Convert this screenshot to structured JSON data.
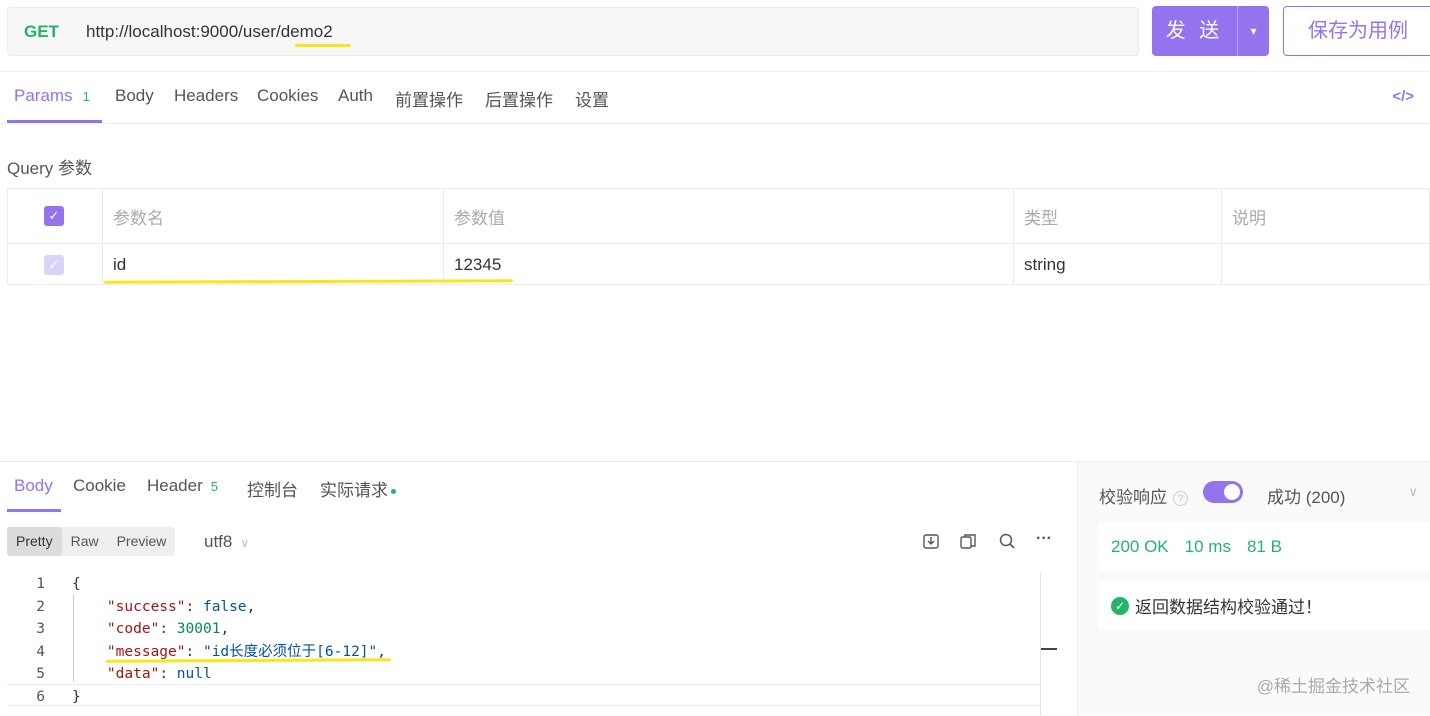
{
  "request": {
    "method": "GET",
    "url_prefix": "http://localhost:9000/user/",
    "url_highlight": "demo2",
    "send_label": "发 送",
    "save_label": "保存为用例"
  },
  "request_tabs": {
    "params_label": "Params",
    "params_count": "1",
    "items": [
      "Body",
      "Headers",
      "Cookies",
      "Auth",
      "前置操作",
      "后置操作",
      "设置"
    ],
    "code_icon": "</>"
  },
  "query": {
    "section_label": "Query 参数",
    "headers": [
      "参数名",
      "参数值",
      "类型",
      "说明"
    ],
    "rows": [
      {
        "name": "id",
        "value": "12345",
        "type": "string",
        "desc": ""
      }
    ]
  },
  "response_tabs": {
    "body": "Body",
    "cookie": "Cookie",
    "header": "Header",
    "header_count": "5",
    "console": "控制台",
    "actual_request": "实际请求"
  },
  "format": {
    "options": [
      "Pretty",
      "Raw",
      "Preview"
    ],
    "active": "Pretty",
    "encoding": "utf8"
  },
  "code_lines": [
    {
      "num": "1",
      "parts": [
        [
          "p",
          "{"
        ]
      ]
    },
    {
      "num": "2",
      "parts": [
        [
          "p",
          "    "
        ],
        [
          "k",
          "\"success\""
        ],
        [
          "p",
          ": "
        ],
        [
          "b",
          "false"
        ],
        [
          "p",
          ","
        ]
      ]
    },
    {
      "num": "3",
      "parts": [
        [
          "p",
          "    "
        ],
        [
          "k",
          "\"code\""
        ],
        [
          "p",
          ": "
        ],
        [
          "n",
          "30001"
        ],
        [
          "p",
          ","
        ]
      ]
    },
    {
      "num": "4",
      "parts": [
        [
          "p",
          "    "
        ],
        [
          "k",
          "\"message\""
        ],
        [
          "p",
          ": "
        ],
        [
          "s",
          "\"id长度必须位于[6-12]\""
        ],
        [
          "p",
          ","
        ]
      ]
    },
    {
      "num": "5",
      "parts": [
        [
          "p",
          "    "
        ],
        [
          "k",
          "\"data\""
        ],
        [
          "p",
          ": "
        ],
        [
          "b",
          "null"
        ]
      ]
    },
    {
      "num": "6",
      "parts": [
        [
          "p",
          "}"
        ]
      ]
    }
  ],
  "validation": {
    "title": "校验响应",
    "help": "?",
    "status": "成功 (200)",
    "code": "200 OK",
    "time": "10 ms",
    "size": "81 B",
    "result": "返回数据结构校验通过！"
  },
  "watermark": "@稀土掘金技术社区",
  "colors": {
    "accent": "#9373ee",
    "success": "#24b36b",
    "highlight": "#f5e71b"
  }
}
